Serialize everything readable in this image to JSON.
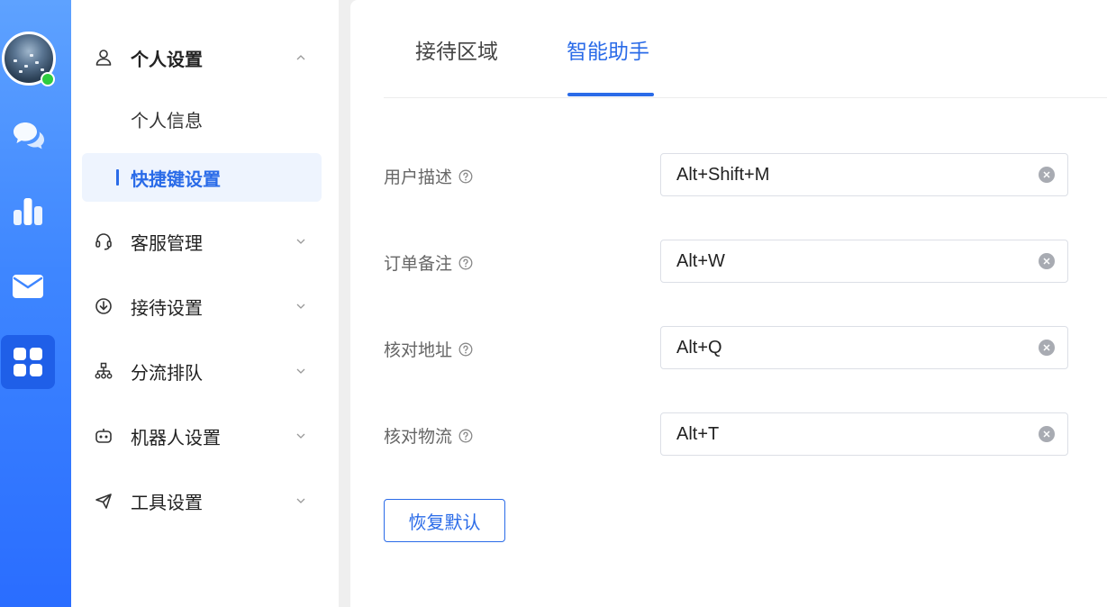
{
  "rail": {
    "icons": [
      "chat-bubbles-icon",
      "bar-chart-icon",
      "mail-icon",
      "apps-grid-icon"
    ],
    "active_icon": "apps-grid-icon",
    "online_color": "#2ecc3f"
  },
  "nav": {
    "personal_settings": "个人设置",
    "personal_info": "个人信息",
    "shortcut_settings": "快捷键设置",
    "customer_service": "客服管理",
    "reception_settings": "接待设置",
    "queue_routing": "分流排队",
    "robot_settings": "机器人设置",
    "tool_settings": "工具设置"
  },
  "tabs": {
    "reception_area": "接待区域",
    "smart_assistant": "智能助手",
    "active": "智能助手"
  },
  "shortcuts": [
    {
      "label": "用户描述",
      "value": "Alt+Shift+M"
    },
    {
      "label": "订单备注",
      "value": "Alt+W"
    },
    {
      "label": "核对地址",
      "value": "Alt+Q"
    },
    {
      "label": "核对物流",
      "value": "Alt+T"
    }
  ],
  "reset_label": "恢复默认",
  "colors": {
    "accent": "#2a6be8",
    "rail": "#3e86ff"
  }
}
